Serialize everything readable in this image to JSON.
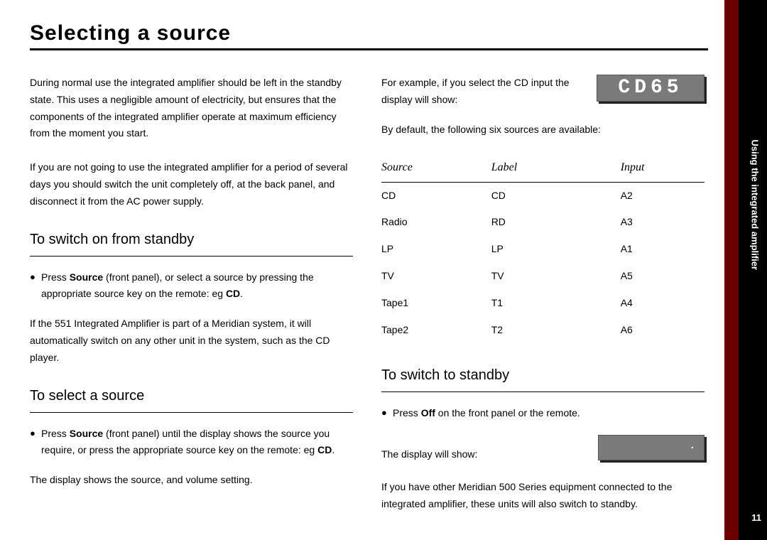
{
  "title": "Selecting a source",
  "side": {
    "section": "Using the integrated amplifier",
    "page_number": "11"
  },
  "left": {
    "intro1": "During normal use the integrated amplifier should be left in the standby state. This uses a negligible amount of electricity, but ensures that the components of the integrated amplifier operate at maximum efficiency from the moment you start.",
    "intro2": "If you are not going to use the integrated amplifier for a period of several days you should switch the unit completely off, at the back panel, and disconnect it from the AC power supply.",
    "h1": "To switch on from standby",
    "b1_pre": "Press ",
    "b1_bold1": "Source",
    "b1_mid": " (front panel), or select a source by pressing the appropriate source key on the remote: eg ",
    "b1_bold2": "CD",
    "b1_post": ".",
    "p_after_b1": "If the 551 Integrated Amplifier is part of a Meridian system, it will automatically switch on any other unit in the system, such as the CD player.",
    "h2": "To select a source",
    "b2_pre": "Press ",
    "b2_bold1": "Source",
    "b2_mid": " (front panel) until the display shows the source you require, or press the appropriate source key on the remote: eg ",
    "b2_bold2": "CD",
    "b2_post": ".",
    "p_after_b2": "The display shows the source, and volume setting."
  },
  "right": {
    "example_text": "For example, if you select the CD input the display will show:",
    "lcd1": "CD65",
    "default_text": "By default, the following six sources are available:",
    "table": {
      "headers": {
        "c1": "Source",
        "c2": "Label",
        "c3": "Input"
      },
      "rows": [
        {
          "c1": "CD",
          "c2": "CD",
          "c3": "A2"
        },
        {
          "c1": "Radio",
          "c2": "RD",
          "c3": "A3"
        },
        {
          "c1": "LP",
          "c2": "LP",
          "c3": "A1"
        },
        {
          "c1": "TV",
          "c2": "TV",
          "c3": "A5"
        },
        {
          "c1": "Tape1",
          "c2": "T1",
          "c3": "A4"
        },
        {
          "c1": "Tape2",
          "c2": "T2",
          "c3": "A6"
        }
      ]
    },
    "h3": "To switch to standby",
    "b3_pre": "Press ",
    "b3_bold": "Off",
    "b3_post": " on the front panel or the remote.",
    "display_will_show": "The display will show:",
    "lcd2": "·",
    "closing": "If you have other Meridian 500 Series equipment connected to the integrated amplifier, these units will also switch to standby."
  }
}
